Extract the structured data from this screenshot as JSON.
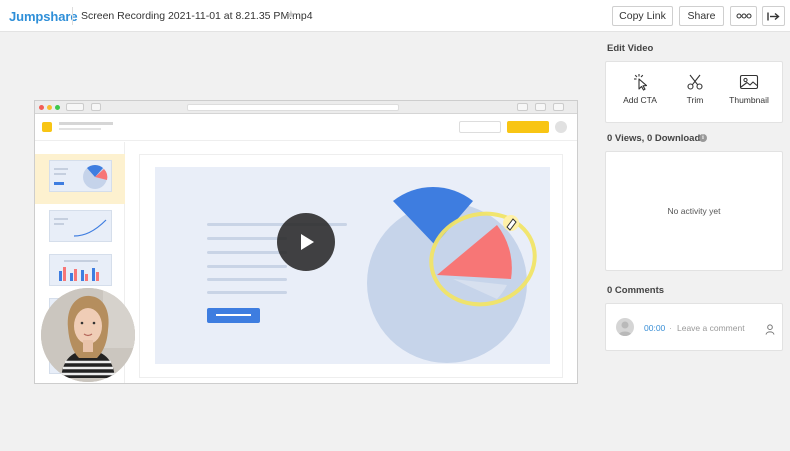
{
  "header": {
    "logo": "Jumpshare",
    "file_title": "Screen Recording 2021-11-01 at 8.21.35 PM.mp4",
    "star_icon": "star-icon",
    "copy_link_label": "Copy Link",
    "share_label": "Share",
    "more_icon": "more-dots-icon",
    "exit_icon": "exit-arrow-icon"
  },
  "player": {
    "play_icon": "play-icon",
    "webcam": "webcam-overlay"
  },
  "edit_video": {
    "title": "Edit Video",
    "tools": [
      {
        "label": "Add CTA",
        "icon": "cursor-click-icon"
      },
      {
        "label": "Trim",
        "icon": "scissors-icon"
      },
      {
        "label": "Thumbnail",
        "icon": "image-icon"
      }
    ]
  },
  "activity": {
    "title": "0 Views, 0 Downloads",
    "info_icon": "info-icon",
    "empty_text": "No activity yet"
  },
  "comments": {
    "title": "0 Comments",
    "timestamp": "00:00",
    "separator": "·",
    "placeholder": "Leave a comment",
    "user_icon": "user-icon"
  },
  "colors": {
    "brand": "#2f8fd8",
    "accent_yellow": "#f8c514",
    "pie_blue": "#3e7de0",
    "pie_red": "#f77676",
    "link_blue": "#3a8fd6"
  }
}
